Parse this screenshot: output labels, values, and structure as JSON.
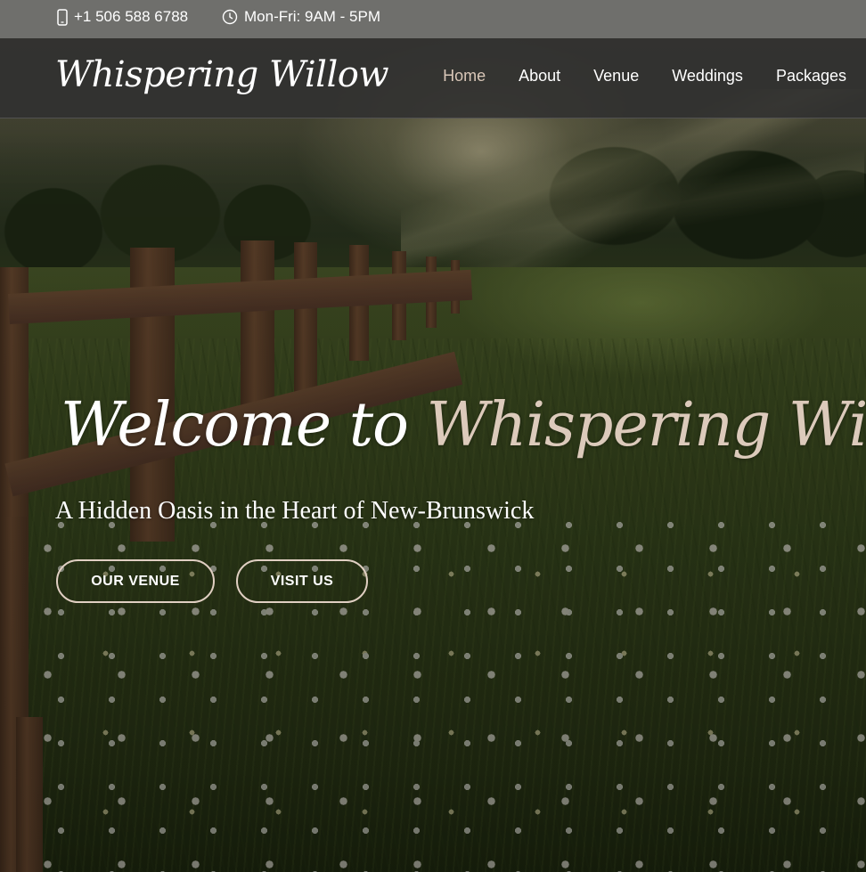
{
  "topbar": {
    "phone_icon": "mobile-phone-icon",
    "phone": "+1 506 588 6788",
    "hours_icon": "clock-icon",
    "hours": "Mon-Fri: 9AM - 5PM"
  },
  "header": {
    "logo": "Whispering Willow",
    "nav": [
      {
        "label": "Home",
        "active": true
      },
      {
        "label": "About"
      },
      {
        "label": "Venue"
      },
      {
        "label": "Weddings"
      },
      {
        "label": "Packages"
      }
    ]
  },
  "hero": {
    "title_prefix": "Welcome to",
    "title_accent": "Whispering Willow",
    "subtitle": "A Hidden Oasis in the Heart of New-Brunswick",
    "buttons": {
      "venue": "OUR VENUE",
      "visit": "VISIT US"
    }
  },
  "colors": {
    "accent": "#dccabb",
    "nav_active": "#d9c7b8",
    "button_border": "#e0cfc2",
    "topbar_bg": "#787878",
    "navbar_bg": "#303030"
  }
}
